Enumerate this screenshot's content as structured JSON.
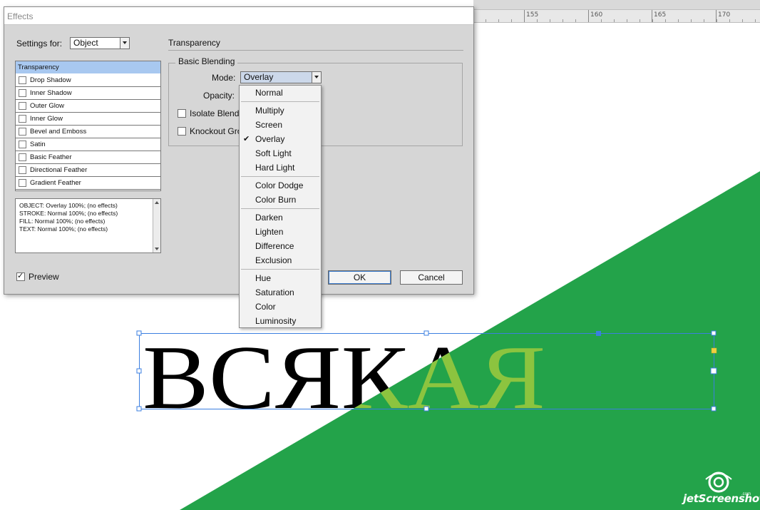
{
  "ruler": {
    "labels": [
      "155",
      "160",
      "165",
      "170"
    ]
  },
  "artboard": {
    "text": "ВСЯКАЯ",
    "shape_color": "#23a34a",
    "text_color": "#000000",
    "overlay_text_color": "#8cc43f",
    "selection_color": "#3b7fe0"
  },
  "watermark": {
    "text": "jetScreenshot",
    "suffix": ".com"
  },
  "dialog": {
    "title": "Effects",
    "settings_for_label": "Settings for:",
    "settings_for_value": "Object",
    "effects": [
      {
        "label": "Transparency",
        "selected": true,
        "has_checkbox": false
      },
      {
        "label": "Drop Shadow",
        "selected": false,
        "has_checkbox": true
      },
      {
        "label": "Inner Shadow",
        "selected": false,
        "has_checkbox": true
      },
      {
        "label": "Outer Glow",
        "selected": false,
        "has_checkbox": true
      },
      {
        "label": "Inner Glow",
        "selected": false,
        "has_checkbox": true
      },
      {
        "label": "Bevel and Emboss",
        "selected": false,
        "has_checkbox": true
      },
      {
        "label": "Satin",
        "selected": false,
        "has_checkbox": true
      },
      {
        "label": "Basic Feather",
        "selected": false,
        "has_checkbox": true
      },
      {
        "label": "Directional Feather",
        "selected": false,
        "has_checkbox": true
      },
      {
        "label": "Gradient Feather",
        "selected": false,
        "has_checkbox": true
      }
    ],
    "summary_lines": [
      "OBJECT: Overlay 100%; (no effects)",
      "STROKE: Normal 100%; (no effects)",
      "FILL: Normal 100%; (no effects)",
      "TEXT: Normal 100%; (no effects)"
    ],
    "preview_label": "Preview",
    "preview_checked": true,
    "section_title": "Transparency",
    "basic_blending": {
      "legend": "Basic Blending",
      "mode_label": "Mode:",
      "mode_value": "Overlay",
      "opacity_label": "Opacity:",
      "isolate_label": "Isolate Blending",
      "knockout_label": "Knockout Group"
    },
    "ok_label": "OK",
    "cancel_label": "Cancel"
  },
  "mode_menu": {
    "groups": [
      [
        "Normal"
      ],
      [
        "Multiply",
        "Screen",
        "Overlay",
        "Soft Light",
        "Hard Light"
      ],
      [
        "Color Dodge",
        "Color Burn"
      ],
      [
        "Darken",
        "Lighten",
        "Difference",
        "Exclusion"
      ],
      [
        "Hue",
        "Saturation",
        "Color",
        "Luminosity"
      ]
    ],
    "selected": "Overlay"
  }
}
